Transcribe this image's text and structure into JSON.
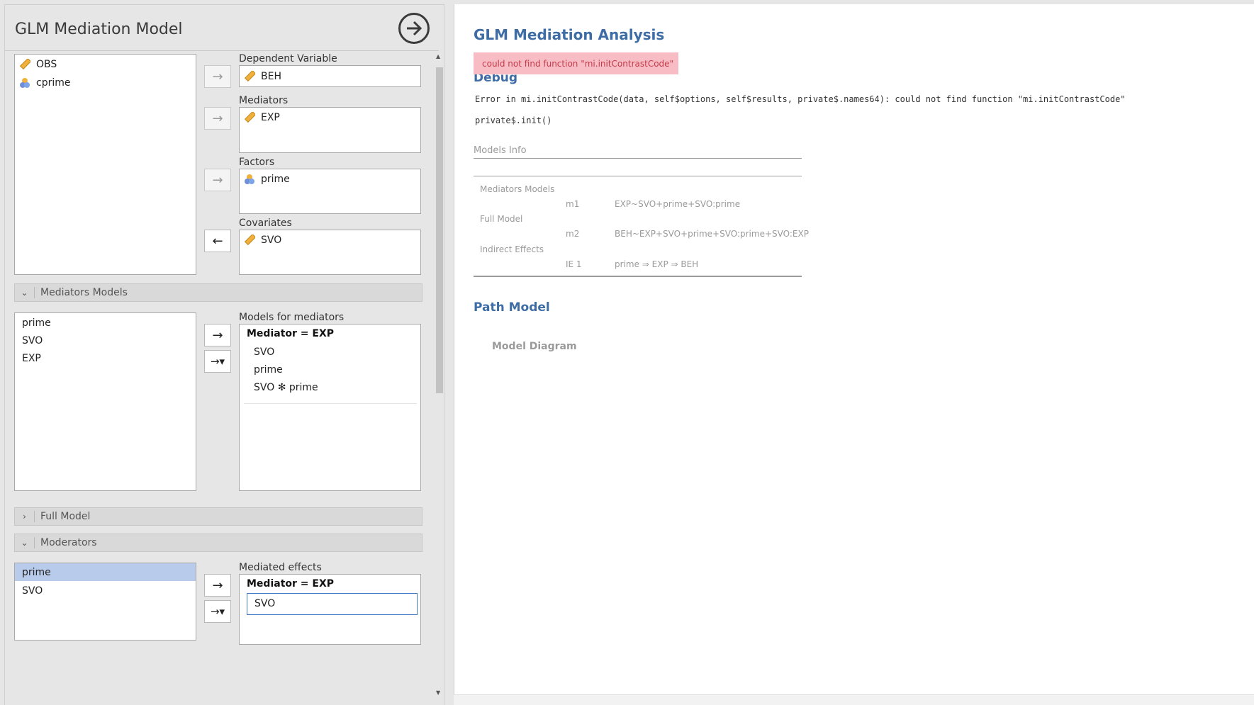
{
  "options": {
    "title": "GLM Mediation Model",
    "available_variables": [
      {
        "name": "OBS",
        "icon": "continuous-ruler-icon"
      },
      {
        "name": "cprime",
        "icon": "nominal-circles-icon"
      }
    ],
    "dependent": {
      "label": "Dependent Variable",
      "value": "BEH",
      "icon": "continuous-ruler-icon"
    },
    "mediators": {
      "label": "Mediators",
      "items": [
        "EXP"
      ]
    },
    "factors": {
      "label": "Factors",
      "items": [
        "prime"
      ]
    },
    "covariates": {
      "label": "Covariates",
      "items": [
        "SVO"
      ]
    },
    "sections": {
      "mediators_models": "Mediators Models",
      "full_model": "Full Model",
      "moderators": "Moderators"
    },
    "mediators_models": {
      "available": [
        "prime",
        "SVO",
        "EXP"
      ],
      "models_label": "Models for mediators",
      "mediator_header": "Mediator = EXP",
      "terms": [
        "SVO",
        "prime",
        "SVO ✻ prime"
      ]
    },
    "moderators": {
      "available": [
        "prime",
        "SVO"
      ],
      "selected": "prime",
      "effects_label": "Mediated effects",
      "mediator_header": "Mediator = EXP",
      "input_value": "SVO"
    }
  },
  "results": {
    "title": "GLM Mediation Analysis",
    "error": "could not find function \"mi.initContrastCode\"",
    "debug_title": "Debug",
    "debug_line1": "Error in mi.initContrastCode(data, self$options, self$results, private$.names64): could not find function \"mi.initContrastCode\"",
    "debug_line2": "private$.init()",
    "models_info_title": "Models Info",
    "models_info_rows": [
      {
        "label": "Mediators Models",
        "key": "",
        "value": ""
      },
      {
        "label": "",
        "key": "m1",
        "value": "EXP~SVO+prime+SVO:prime"
      },
      {
        "label": "Full Model",
        "key": "",
        "value": ""
      },
      {
        "label": "",
        "key": "m2",
        "value": "BEH~EXP+SVO+prime+SVO:prime+SVO:EXP"
      },
      {
        "label": "Indirect Effects",
        "key": "",
        "value": ""
      },
      {
        "label": "",
        "key": "IE 1",
        "value": "prime ⇒ EXP ⇒ BEH"
      }
    ],
    "path_model_title": "Path Model",
    "model_diagram_label": "Model Diagram"
  },
  "colors": {
    "accent": "#3e6da6",
    "error_bg": "#f8bcc4",
    "error_text": "#c33a4a",
    "selection": "#b9cbea"
  }
}
